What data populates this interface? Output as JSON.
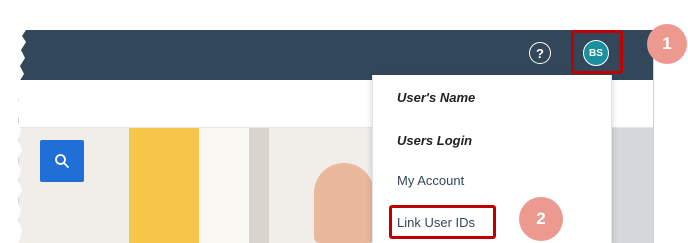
{
  "header": {
    "help_label": "?",
    "avatar_initials": "BS"
  },
  "user_menu": {
    "user_name": "User's Name",
    "user_login": "Users Login",
    "my_account": "My Account",
    "link_user_ids": "Link User IDs"
  },
  "callouts": {
    "step1": "1",
    "step2": "2"
  },
  "colors": {
    "header_bg": "#33475b",
    "avatar_bg": "#1a8fa0",
    "highlight": "#c00000",
    "callout": "#ec9a90",
    "search_button": "#1f6fd6"
  },
  "icons": {
    "help": "question-circle-icon",
    "search": "search-icon"
  }
}
